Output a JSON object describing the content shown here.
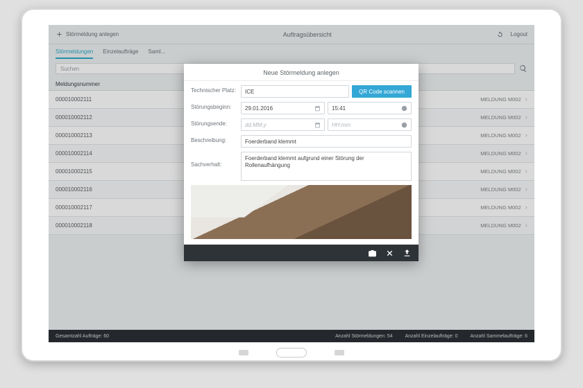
{
  "header": {
    "add_label": "Störmeldung anlegen",
    "title": "Auftragsübersicht",
    "logout_label": "Logout"
  },
  "tabs": {
    "t0": "Störmeldungen",
    "t1": "Einzelaufträge",
    "t2": "Saml..."
  },
  "search": {
    "placeholder": "Suchen"
  },
  "columns": {
    "c0": "Meldungsnummer"
  },
  "rows": [
    {
      "id": "000010002111",
      "txt": "MELDUNG M002"
    },
    {
      "id": "000010002112",
      "txt": "MELDUNG M002"
    },
    {
      "id": "000010002113",
      "txt": "MELDUNG M002"
    },
    {
      "id": "000010002114",
      "txt": "MELDUNG M002"
    },
    {
      "id": "000010002115",
      "txt": "MELDUNG M002"
    },
    {
      "id": "000010002116",
      "txt": "MELDUNG M002"
    },
    {
      "id": "000010002117",
      "txt": "MELDUNG M002"
    },
    {
      "id": "000010002118",
      "txt": "MELDUNG M002"
    }
  ],
  "footer": {
    "left": "Gesamtzahl Aufträge: 60",
    "r1": "Anzahl Störmeldungen: 54",
    "r2": "Anzahl Einzelaufträge: 0",
    "r3": "Anzahl Sammelaufträge: 6"
  },
  "dialog": {
    "title": "Neue Störmeldung anlegen",
    "labels": {
      "platz": "Technischer Platz:",
      "beginn": "Störungsbeginn:",
      "ende": "Störungsende:",
      "beschr": "Beschreibung:",
      "sachv": "Sachverhalt:"
    },
    "values": {
      "platz": "ICE",
      "qr": "QR Code scannen",
      "date_begin": "29.01.2016",
      "time_begin": "15:41",
      "date_end_ph": "dd.MM.y",
      "time_end_ph": "HH:mm",
      "beschr": "Foerderband klemmt",
      "sachv": "Foerderband klemmt aufgrund einer Störung der Rollenaufhängung"
    }
  }
}
